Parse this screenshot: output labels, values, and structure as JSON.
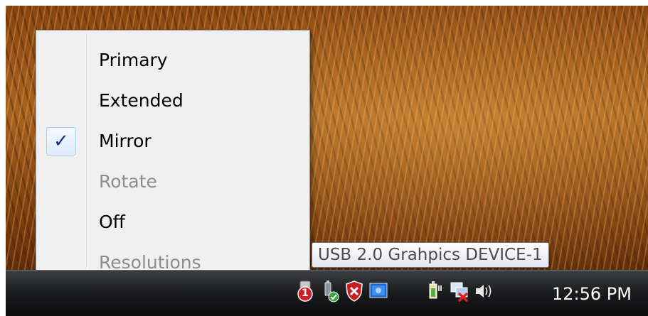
{
  "menu": {
    "items": [
      {
        "label": "Primary",
        "checked": false,
        "disabled": false
      },
      {
        "label": "Extended",
        "checked": false,
        "disabled": false
      },
      {
        "label": "Mirror",
        "checked": true,
        "disabled": false
      },
      {
        "label": "Rotate",
        "checked": false,
        "disabled": true
      },
      {
        "label": "Off",
        "checked": false,
        "disabled": false
      },
      {
        "label": "Resolutions",
        "checked": false,
        "disabled": true
      }
    ],
    "check_glyph": "✓"
  },
  "tooltip": {
    "text": "USB 2.0 Grahpics DEVICE-1"
  },
  "tray": {
    "badge_count": "1",
    "icons": [
      "flag-alert-icon",
      "usb-device-icon",
      "security-shield-icon",
      "display-adapter-icon",
      "power-icon",
      "network-disconnected-icon",
      "volume-icon"
    ],
    "clock": "12:56 PM"
  },
  "colors": {
    "accent_check": "#1b2a8a",
    "disabled_text": "#8d8d8d",
    "badge_red": "#d21e1e"
  }
}
